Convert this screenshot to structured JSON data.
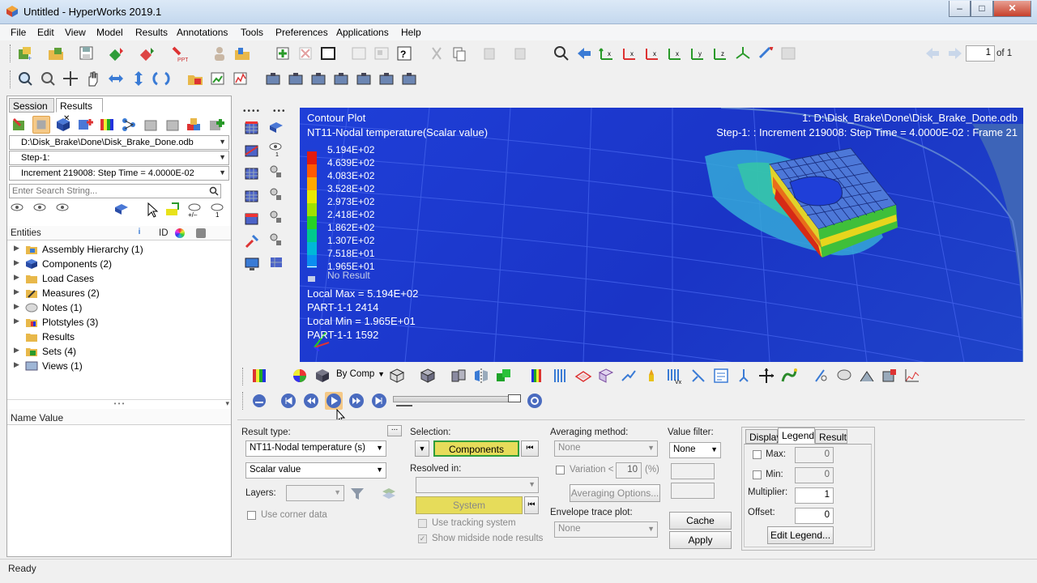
{
  "window": {
    "title": "Untitled - HyperWorks 2019.1",
    "minimize": "–",
    "maximize": "□",
    "close": "✕"
  },
  "menu": [
    "File",
    "Edit",
    "View",
    "Model",
    "Results",
    "Annotations",
    "Tools",
    "Preferences",
    "Applications",
    "Help"
  ],
  "page_nav": {
    "current": "1",
    "of": "of 1"
  },
  "left_panel": {
    "tabs": [
      "Session",
      "Results"
    ],
    "tab_close": "✕",
    "file_combo": "D:\\Disk_Brake\\Done\\Disk_Brake_Done.odb",
    "step_combo": "Step-1:",
    "increment_combo": "Increment    219008: Step Time =    4.0000E-02",
    "search_placeholder": "Enter Search String...",
    "entities_header": "Entities",
    "id_header": "ID",
    "tree": [
      "Assembly Hierarchy (1)",
      "Components (2)",
      "Load Cases",
      "Measures (2)",
      "Notes (1)",
      "Plotstyles (3)",
      "Results",
      "Sets (4)",
      "Views (1)"
    ],
    "name_value_header": "Name Value",
    "splitter": "• • •"
  },
  "viewport": {
    "title": "Contour Plot",
    "subtitle": "NT11-Nodal temperature(Scalar value)",
    "file_info": "1: D:\\Disk_Brake\\Done\\Disk_Brake_Done.odb",
    "step_info": "Step-1: : Increment    219008: Step Time =    4.0000E-02 : Frame 21",
    "legend_values": [
      "5.194E+02",
      "4.639E+02",
      "4.083E+02",
      "3.528E+02",
      "2.973E+02",
      "2.418E+02",
      "1.862E+02",
      "1.307E+02",
      "7.518E+01",
      "1.965E+01"
    ],
    "legend_colors": [
      "#e11b0e",
      "#ff5a00",
      "#ffa800",
      "#e8e800",
      "#9fe000",
      "#27d226",
      "#00c98d",
      "#00b8d8",
      "#0a8ef0",
      "#1b49e8"
    ],
    "no_result": "No Result",
    "local_max": "Local Max =  5.194E+02",
    "max_location": "PART-1-1 2414",
    "local_min": "Local Min =  1.965E+01",
    "min_location": "PART-1-1 1592"
  },
  "contour_toolbar": {
    "by_comp": "By Comp"
  },
  "bottom": {
    "result_type_label": "Result type:",
    "result_type": "NT11-Nodal temperature (s)",
    "scalar": "Scalar value",
    "layers_label": "Layers:",
    "use_corner_data": "Use corner data",
    "more_button": "...",
    "selection_label": "Selection:",
    "components_button": "Components",
    "resolved_in_label": "Resolved in:",
    "system_button": "System",
    "use_tracking": "Use tracking system",
    "show_midside": "Show midside node results",
    "averaging_label": "Averaging method:",
    "averaging_value": "None",
    "variation_label": "Variation <",
    "variation_value": "10",
    "variation_unit": "(%)",
    "averaging_options": "Averaging Options...",
    "envelope_label": "Envelope trace plot:",
    "envelope_value": "None",
    "value_filter_label": "Value filter:",
    "value_filter": "None",
    "cache_button": "Cache",
    "apply_button": "Apply",
    "tabs": [
      "Display",
      "Legend",
      "Result"
    ],
    "max_label": "Max:",
    "max_value": "0",
    "min_label": "Min:",
    "min_value": "0",
    "multiplier_label": "Multiplier:",
    "multiplier_value": "1",
    "offset_label": "Offset:",
    "offset_value": "0",
    "edit_legend": "Edit Legend..."
  },
  "status": "Ready",
  "colors": {
    "viewport_blue": "#1f3fd8",
    "components_yellow": "#e6dc5a",
    "accent": "#2f6fc0"
  }
}
